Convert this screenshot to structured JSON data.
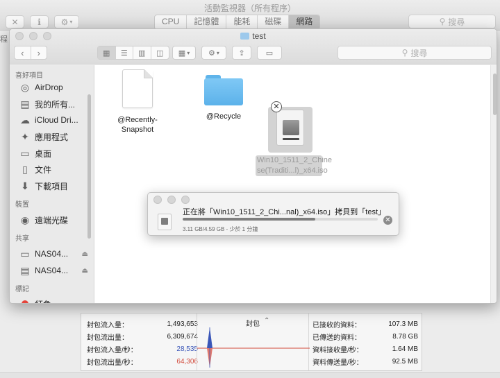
{
  "activity_monitor": {
    "window_title": "活動監視器（所有程序）",
    "tabs": [
      {
        "label": "CPU"
      },
      {
        "label": "記憶體"
      },
      {
        "label": "能耗"
      },
      {
        "label": "磁碟"
      },
      {
        "label": "網路"
      }
    ],
    "active_tab": "網路",
    "search_placeholder": "搜尋",
    "column_snippet": "程",
    "stats": {
      "packets_in_label": "封包流入量：",
      "packets_in": "1,493,653",
      "packets_out_label": "封包流出量：",
      "packets_out": "6,309,674",
      "packets_in_sec_label": "封包流入量/秒：",
      "packets_in_sec": "28,535",
      "packets_out_sec_label": "封包流出量/秒：",
      "packets_out_sec": "64,306",
      "chart_label": "封包",
      "data_received_label": "已接收的資料：",
      "data_received": "107.3 MB",
      "data_sent_label": "已傳送的資料：",
      "data_sent": "8.78 GB",
      "data_received_sec_label": "資料接收量/秒：",
      "data_received_sec": "1.64 MB",
      "data_sent_sec_label": "資料傳送量/秒：",
      "data_sent_sec": "92.5 MB"
    },
    "colors": {
      "in": "#3a56b8",
      "out": "#d24a3b"
    }
  },
  "finder": {
    "title": "test",
    "search_placeholder": "搜尋",
    "sidebar": {
      "favorites_header": "喜好項目",
      "favorites": [
        {
          "label": "AirDrop",
          "icon": "airdrop-icon"
        },
        {
          "label": "我的所有...",
          "icon": "all-files-icon"
        },
        {
          "label": "iCloud Dri...",
          "icon": "cloud-icon"
        },
        {
          "label": "應用程式",
          "icon": "applications-icon"
        },
        {
          "label": "桌面",
          "icon": "desktop-icon"
        },
        {
          "label": "文件",
          "icon": "documents-icon"
        },
        {
          "label": "下載項目",
          "icon": "downloads-icon"
        }
      ],
      "devices_header": "裝置",
      "devices": [
        {
          "label": "遠端光碟",
          "icon": "remote-disc-icon"
        }
      ],
      "shared_header": "共享",
      "shared": [
        {
          "label": "NAS04...",
          "icon": "monitor-icon"
        },
        {
          "label": "NAS04...",
          "icon": "server-icon"
        }
      ],
      "tags_header": "標記",
      "tags": [
        {
          "label": "紅色",
          "color": "#e5443b"
        }
      ]
    },
    "files": [
      {
        "name": "@Recently-Snapshot",
        "line1": "@Recently-",
        "line2": "Snapshot",
        "type": "document"
      },
      {
        "name": "@Recycle",
        "type": "folder"
      },
      {
        "name": "Win10_1511_2_Chinese(Traditi...l)_x64.iso",
        "line1": "Win10_1511_2_Chine",
        "line2": "se(Traditi...l)_x64.iso",
        "type": "disk-image",
        "copying": true
      }
    ]
  },
  "copy_dialog": {
    "message": "正在將「Win10_1511_2_Chi...nal)_x64.iso」拷貝到「test」",
    "progress_text": "3.11 GB/4.59 GB - 少於 1 分鐘",
    "progress_fraction": 0.678
  }
}
